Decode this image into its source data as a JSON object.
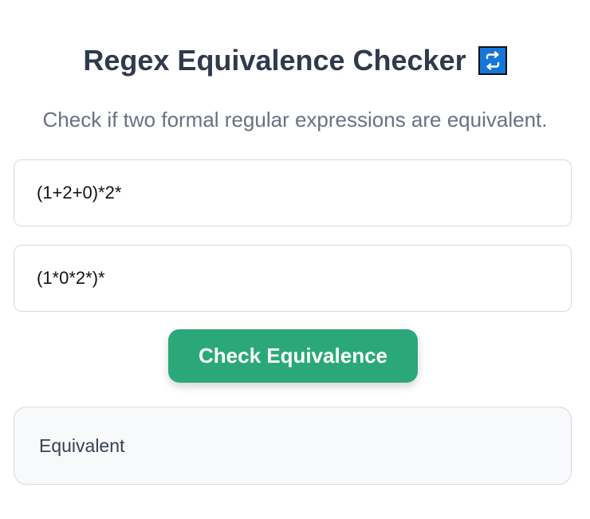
{
  "header": {
    "title": "Regex Equivalence Checker",
    "title_icon": "repeat-arrows-icon",
    "subtitle": "Check if two formal regular expressions are equivalent."
  },
  "inputs": {
    "regex_1": {
      "value": "(1+2+0)*2*"
    },
    "regex_2": {
      "value": "(1*0*2*)*"
    }
  },
  "actions": {
    "check_label": "Check Equivalence"
  },
  "result": {
    "text": "Equivalent"
  },
  "colors": {
    "accent": "#2ba87a",
    "title_text": "#2f3a4c",
    "subtitle_text": "#687180",
    "icon_background": "#1677d8",
    "result_background": "#f8f9fb"
  }
}
